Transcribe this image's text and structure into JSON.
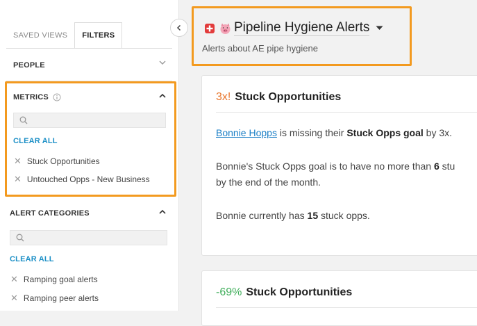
{
  "sidebar": {
    "tabs": [
      {
        "label": "SAVED VIEWS",
        "active": false
      },
      {
        "label": "FILTERS",
        "active": true
      }
    ],
    "people": {
      "label": "PEOPLE"
    },
    "metrics": {
      "label": "METRICS",
      "search_placeholder": "",
      "clear_all": "CLEAR ALL",
      "items": [
        "Stuck Opportunities",
        "Untouched Opps - New Business"
      ]
    },
    "alert_categories": {
      "label": "ALERT CATEGORIES",
      "search_placeholder": "",
      "clear_all": "CLEAR ALL",
      "items": [
        "Ramping goal alerts",
        "Ramping peer alerts"
      ]
    }
  },
  "header": {
    "title": "Pipeline Hygiene Alerts",
    "subtitle": "Alerts about AE pipe hygiene"
  },
  "cards": [
    {
      "change": "3x!",
      "change_color": "#e8772e",
      "metric": "Stuck Opportunities",
      "line1_name": "Bonnie Hopps",
      "line1_mid": " is missing their ",
      "line1_goal": "Stuck Opps goal",
      "line1_end": " by 3x.",
      "line2_start": "Bonnie's Stuck Opps goal is to have no more than ",
      "line2_num": "6",
      "line2_end": " stu",
      "line3": "by the end of the month.",
      "line4_start": "Bonnie currently has ",
      "line4_num": "15",
      "line4_end": " stuck opps."
    },
    {
      "change": "-69%",
      "change_color": "#3fae5a",
      "metric": "Stuck Opportunities"
    }
  ],
  "colors": {
    "accent_orange": "#f39a1f",
    "link_blue": "#1b8fc6"
  }
}
